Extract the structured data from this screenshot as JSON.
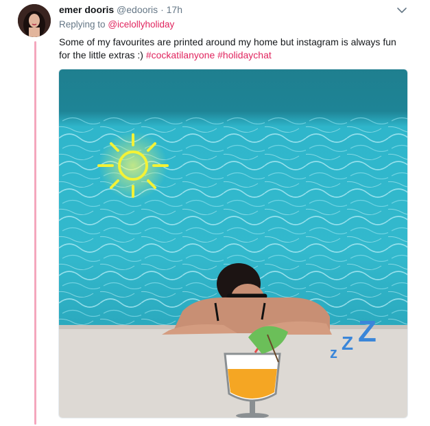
{
  "tweet": {
    "author_name": "emer dooris",
    "author_handle": "@edooris",
    "separator": "·",
    "time": "17h",
    "replying_prefix": "Replying to",
    "replying_to": "@icelollyholiday",
    "text": "Some of my favourites are printed around my home but instagram is always fun for the little extras :)",
    "hashtags": [
      "#cockatilanyone",
      "#holidaychat"
    ],
    "menu_icon": "chevron-down-icon"
  },
  "media": {
    "sticker_sleep_text": "zZZ",
    "stickers": [
      "sun-sticker",
      "cocktail-sticker",
      "sleep-zzz-sticker"
    ]
  },
  "colors": {
    "thread_line": "#f4a7bd",
    "link": "#e0245e",
    "muted": "#657786",
    "pool": "#2bb3c8",
    "sun": "#f3f236",
    "zzz": "#3a86d9"
  }
}
